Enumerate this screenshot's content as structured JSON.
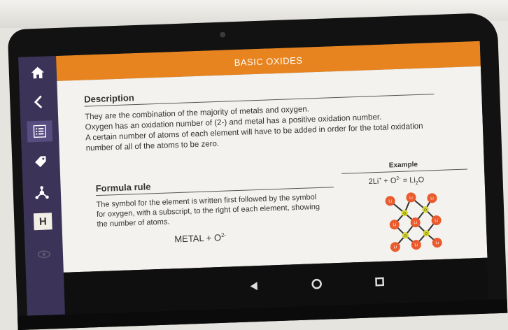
{
  "app": {
    "title": "BASIC OXIDES"
  },
  "sidebar": {
    "items": [
      {
        "icon": "home-icon"
      },
      {
        "icon": "back-arrow-icon"
      },
      {
        "icon": "list-icon"
      },
      {
        "icon": "tag-icon"
      },
      {
        "icon": "molecule-icon"
      },
      {
        "icon": "h-element-icon",
        "label": "H"
      },
      {
        "icon": "faded-icon"
      }
    ]
  },
  "description": {
    "heading": "Description",
    "lines": [
      "They are the combination of the majority of metals and oxygen.",
      "Oxygen has an oxidation number of (2-) and metal has a positive oxidation number.",
      "A certain number of atoms of each element will have to be added in order for the total oxidation",
      "number of all of the atoms to be zero."
    ]
  },
  "formula_rule": {
    "heading": "Formula rule",
    "lines": [
      "The symbol for the element is written first followed by the symbol",
      "for oxygen, with a subscript, to the right of each element, showing",
      "the number of atoms."
    ],
    "equation_main": "METAL + O",
    "equation_sup": "2-"
  },
  "example": {
    "heading": "Example",
    "eq_coef": "2Li",
    "eq_sup1": "+",
    "eq_plus": " + O",
    "eq_sup2": "2-",
    "eq_equals": " = Li",
    "eq_sub": "2",
    "eq_tail": "O",
    "atom_labels": {
      "li": "Li",
      "o": "O"
    }
  },
  "navigation": {
    "buttons": [
      {
        "icon": "back-triangle-icon"
      },
      {
        "icon": "home-circle-icon"
      },
      {
        "icon": "recents-square-icon"
      }
    ]
  },
  "colors": {
    "header": "#e8841f",
    "sidebar": "#3b3458",
    "li_atom": "#ea5a2c",
    "o_atom": "#d6d62a"
  }
}
